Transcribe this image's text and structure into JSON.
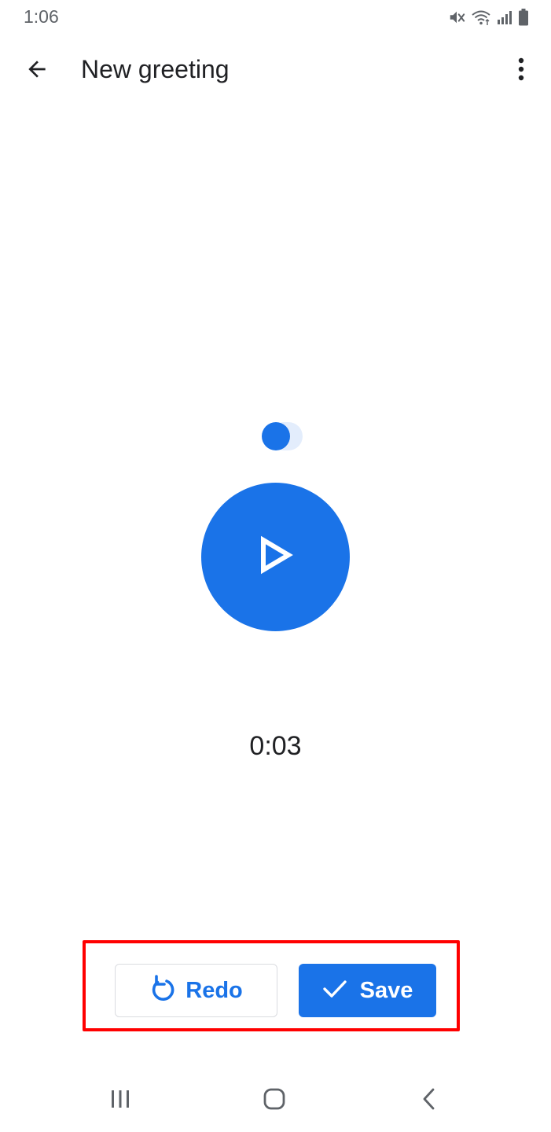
{
  "status_bar": {
    "time": "1:06",
    "icons": [
      "mute-icon",
      "wifi-icon",
      "signal-icon",
      "battery-icon"
    ]
  },
  "app_bar": {
    "title": "New greeting",
    "back_icon": "arrow-back-icon",
    "menu_icon": "more-vert-icon"
  },
  "player": {
    "play_icon": "play-icon",
    "elapsed": "0:03"
  },
  "actions": {
    "redo_label": "Redo",
    "redo_icon": "redo-icon",
    "save_label": "Save",
    "save_icon": "check-icon"
  },
  "nav_bar": {
    "icons": [
      "recents-icon",
      "home-icon",
      "back-icon"
    ]
  },
  "colors": {
    "accent": "#1a73e8",
    "accent_light": "#e3edfc",
    "highlight": "#ff0000",
    "text": "#202124",
    "muted": "#5f6368"
  }
}
